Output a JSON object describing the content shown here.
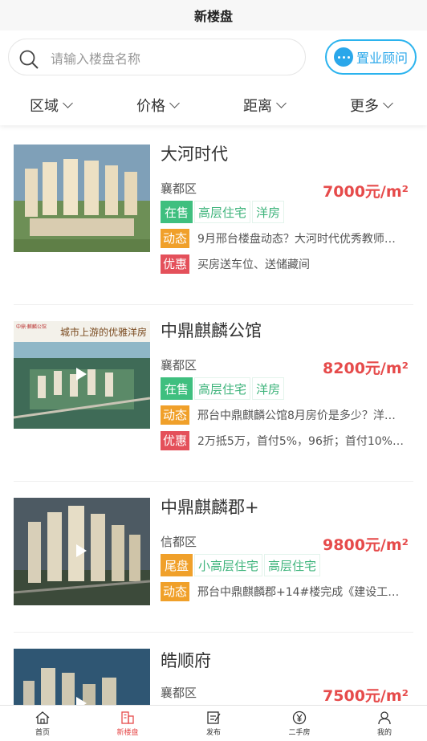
{
  "header": {
    "title": "新楼盘"
  },
  "search": {
    "placeholder": "请输入楼盘名称",
    "advisor_label": "置业顾问",
    "accent": "#2aa7ea"
  },
  "filters": [
    "区域",
    "价格",
    "距离",
    "更多"
  ],
  "listings": [
    {
      "name": "大河时代",
      "district": "襄都区",
      "price": "7000元/m²",
      "video": false,
      "tags": [
        {
          "label": "在售",
          "style": "solid"
        },
        {
          "label": "高层住宅",
          "style": "outline"
        },
        {
          "label": "洋房",
          "style": "outline"
        }
      ],
      "info": [
        {
          "badge": "动态",
          "type": "dyn",
          "text": "9月邢台楼盘动态？大河时代优秀教师…"
        },
        {
          "badge": "优惠",
          "type": "promo",
          "text": "买房送车位、送储藏间"
        }
      ]
    },
    {
      "name": "中鼎麒麟公馆",
      "district": "襄都区",
      "price": "8200元/m²",
      "video": true,
      "thumb_caption": "城市上游的优雅洋房",
      "thumb_logo": "中鼎·麒麟公馆",
      "tags": [
        {
          "label": "在售",
          "style": "solid"
        },
        {
          "label": "高层住宅",
          "style": "outline"
        },
        {
          "label": "洋房",
          "style": "outline"
        }
      ],
      "info": [
        {
          "badge": "动态",
          "type": "dyn",
          "text": "邢台中鼎麒麟公馆8月房价是多少？洋…"
        },
        {
          "badge": "优惠",
          "type": "promo",
          "text": "2万抵5万，首付5%，96折；首付10%…"
        }
      ]
    },
    {
      "name": "中鼎麒麟郡+",
      "district": "信都区",
      "price": "9800元/m²",
      "video": true,
      "tags": [
        {
          "label": "尾盘",
          "style": "orange"
        },
        {
          "label": "小高层住宅",
          "style": "outline"
        },
        {
          "label": "高层住宅",
          "style": "outline"
        }
      ],
      "info": [
        {
          "badge": "动态",
          "type": "dyn",
          "text": "邢台中鼎麒麟郡+14#楼完成《建设工…"
        }
      ]
    },
    {
      "name": "皓顺府",
      "district": "襄都区",
      "price": "7500元/m²",
      "video": true,
      "tags": [],
      "info": []
    }
  ],
  "tabbar": [
    {
      "label": "首页",
      "icon": "home-icon",
      "active": false
    },
    {
      "label": "新楼盘",
      "icon": "building-icon",
      "active": true
    },
    {
      "label": "发布",
      "icon": "edit-icon",
      "active": false
    },
    {
      "label": "二手房",
      "icon": "yuan-icon",
      "active": false
    },
    {
      "label": "我的",
      "icon": "user-icon",
      "active": false
    }
  ],
  "colors": {
    "price": "#e64b4b",
    "on_sale": "#3fbf7f",
    "tail": "#f0a02a",
    "dynamic": "#f0a02a",
    "promo": "#e4505a"
  }
}
